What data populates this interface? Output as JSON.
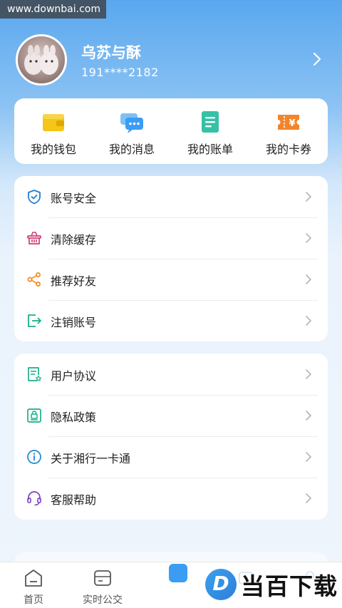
{
  "watermark_top": "www.downbai.com",
  "user": {
    "name": "乌苏与酥",
    "phone": "191****2182"
  },
  "quick_actions": [
    {
      "label": "我的钱包",
      "icon": "wallet-icon"
    },
    {
      "label": "我的消息",
      "icon": "message-icon"
    },
    {
      "label": "我的账单",
      "icon": "bill-icon"
    },
    {
      "label": "我的卡券",
      "icon": "coupon-icon"
    }
  ],
  "settings_group1": [
    {
      "label": "账号安全",
      "icon": "shield-icon"
    },
    {
      "label": "清除缓存",
      "icon": "basket-icon"
    },
    {
      "label": "推荐好友",
      "icon": "share-icon"
    },
    {
      "label": "注销账号",
      "icon": "logout-icon"
    }
  ],
  "settings_group2": [
    {
      "label": "用户协议",
      "icon": "agreement-icon"
    },
    {
      "label": "隐私政策",
      "icon": "privacy-icon"
    },
    {
      "label": "关于湘行一卡通",
      "icon": "info-icon"
    },
    {
      "label": "客服帮助",
      "icon": "headset-icon"
    }
  ],
  "tabbar": {
    "home": "首页",
    "bus": "实时公交"
  },
  "brand_watermark": {
    "logo_letter": "D",
    "text": "当百下载"
  },
  "colors": {
    "accent": "#1f8ee9",
    "wallet": "#f5c518",
    "message": "#3a9df3",
    "bill": "#36c1a6",
    "coupon": "#f2852b",
    "shield": "#1c7ed6",
    "basket": "#d63a76",
    "share": "#f08a24",
    "logout": "#1aaf8a",
    "info": "#1c8bd6",
    "headset": "#7b3fc9"
  }
}
